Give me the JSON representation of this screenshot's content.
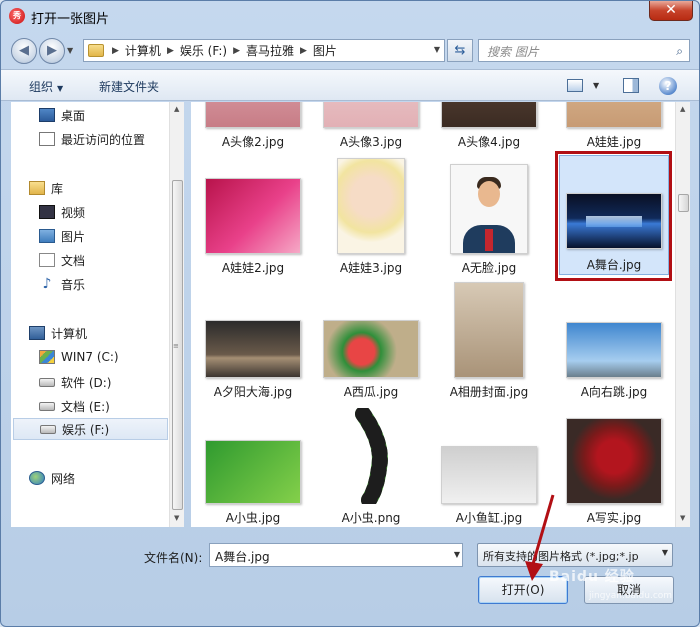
{
  "window": {
    "title": "打开一张图片",
    "close_glyph": "✕"
  },
  "address": {
    "crumbs": [
      "计算机",
      "娱乐 (F:)",
      "喜马拉雅",
      "图片"
    ],
    "search_placeholder": "搜索 图片"
  },
  "toolbar": {
    "organize_label": "组织",
    "new_folder_label": "新建文件夹"
  },
  "nav": {
    "items": [
      {
        "label": "桌面",
        "icon": "desktop-icon"
      },
      {
        "label": "最近访问的位置",
        "icon": "recent-places-icon"
      },
      {
        "label": "库",
        "icon": "library-icon"
      },
      {
        "label": "视频",
        "icon": "video-icon"
      },
      {
        "label": "图片",
        "icon": "pictures-icon"
      },
      {
        "label": "文档",
        "icon": "documents-icon"
      },
      {
        "label": "音乐",
        "icon": "music-icon"
      },
      {
        "label": "计算机",
        "icon": "computer-icon"
      },
      {
        "label": "WIN7 (C:)",
        "icon": "windows-drive-icon"
      },
      {
        "label": "软件 (D:)",
        "icon": "drive-icon"
      },
      {
        "label": "文档 (E:)",
        "icon": "drive-icon"
      },
      {
        "label": "娱乐 (F:)",
        "icon": "drive-icon"
      },
      {
        "label": "网络",
        "icon": "network-icon"
      }
    ],
    "selected": "娱乐 (F:)"
  },
  "files": [
    {
      "name": "A头像2.jpg",
      "thumb": "portrait-photo"
    },
    {
      "name": "A头像3.jpg",
      "thumb": "portrait-photo"
    },
    {
      "name": "A头像4.jpg",
      "thumb": "portrait-photo"
    },
    {
      "name": "A娃娃.jpg",
      "thumb": "doll-photo"
    },
    {
      "name": "A娃娃2.jpg",
      "thumb": "barbie-doll-photo"
    },
    {
      "name": "A娃娃3.jpg",
      "thumb": "bratz-doll-photo"
    },
    {
      "name": "A无脸.jpg",
      "thumb": "faceless-avatar"
    },
    {
      "name": "A舞台.jpg",
      "thumb": "stage-photo"
    },
    {
      "name": "A夕阳大海.jpg",
      "thumb": "sunset-sea-photo"
    },
    {
      "name": "A西瓜.jpg",
      "thumb": "watermelon-photo"
    },
    {
      "name": "A相册封面.jpg",
      "thumb": "album-cover-photo"
    },
    {
      "name": "A向右跳.jpg",
      "thumb": "jump-right-photo"
    },
    {
      "name": "A小虫.jpg",
      "thumb": "bug-photo"
    },
    {
      "name": "A小虫.png",
      "thumb": "caterpillar-image"
    },
    {
      "name": "A小鱼缸.jpg",
      "thumb": "fishbowl-photo"
    },
    {
      "name": "A写实.jpg",
      "thumb": "pomegranate-photo"
    }
  ],
  "selected_file": "A舞台.jpg",
  "bottom": {
    "filename_label": "文件名(N):",
    "filename_value": "A舞台.jpg",
    "filetype_value": "所有支持的图片格式 (*.jpg;*.jp",
    "open_label": "打开(O)",
    "cancel_label": "取消"
  },
  "watermark": {
    "text": "Baidu 经验",
    "sub": "jingyan.baidu.com"
  },
  "colors": {
    "highlight_box": "#b20f14",
    "arrow": "#b20f14",
    "selection": "#d3e5fa"
  }
}
